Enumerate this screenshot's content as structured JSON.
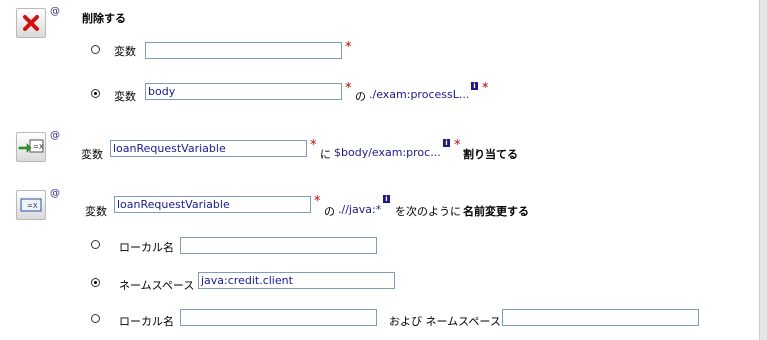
{
  "colors": {
    "required": "#c00000",
    "link": "#1a1a8c",
    "field_border": "#7f9db9"
  },
  "at_symbol": "@",
  "delete_section": {
    "icon": "delete-x-icon",
    "title": "削除する",
    "row1": {
      "label": "変数",
      "value": "",
      "required": "*"
    },
    "row2": {
      "label": "変数",
      "value": "body",
      "required": "*",
      "of": "の",
      "path": "./exam:processL...",
      "info": "i",
      "path_required": "*"
    }
  },
  "assign_section": {
    "icon": "assign-arrow-icon",
    "label": "変数",
    "value": "loanRequestVariable",
    "required": "*",
    "ni": "に",
    "path": "$body/exam:proc...",
    "info": "i",
    "path_required": "*",
    "action": "割り当てる"
  },
  "rename_section": {
    "icon": "rename-field-icon",
    "label": "変数",
    "value": "loanRequestVariable",
    "required": "*",
    "of": "の",
    "path": ".//java:*",
    "info": "i",
    "text_prefix": "を次のように",
    "action": "名前変更する",
    "opt1": {
      "label": "ローカル名",
      "value": ""
    },
    "opt2": {
      "label": "ネームスペース",
      "value": "java:credit.client"
    },
    "opt3": {
      "label": "ローカル名",
      "value": "",
      "and": "および ネームスペース",
      "value2": ""
    }
  }
}
